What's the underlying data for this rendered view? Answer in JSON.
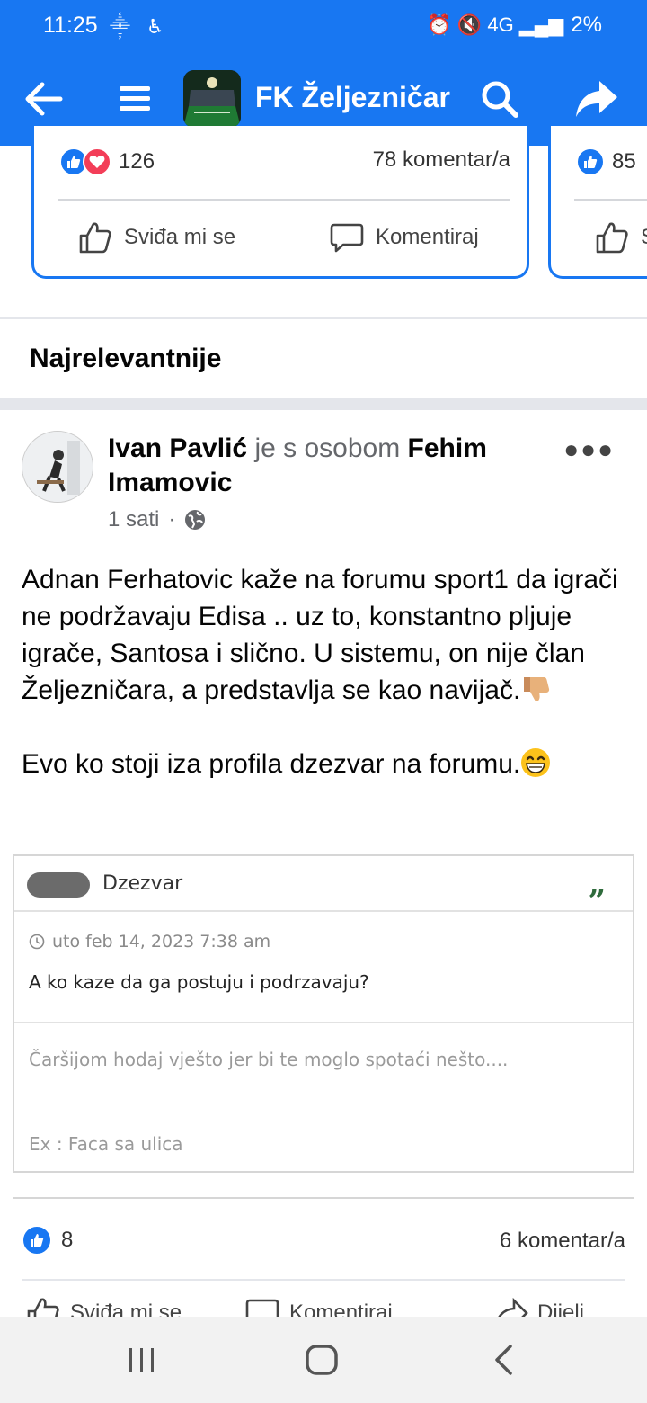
{
  "status_bar": {
    "time": "11:25",
    "left_icons": "⸎ ♿",
    "right_icons": "⏰ 🔇 4G ▂▄▆",
    "battery": "2%"
  },
  "header": {
    "title": "FK Željezničar"
  },
  "carousel": {
    "card1": {
      "reaction_count": "126",
      "comments": "78 komentar/a",
      "like_label": "Sviđa mi se",
      "comment_label": "Komentiraj"
    },
    "card2": {
      "reaction_count": "85",
      "like_label": "S"
    }
  },
  "section": {
    "title": "Najrelevantnije"
  },
  "post": {
    "author": "Ivan Pavlić",
    "with_text": " je s osobom ",
    "tagged": "Fehim Imamovic",
    "time": "1 sati",
    "visibility_separator": "·",
    "paragraph1": "Adnan Ferhatovic kaže na forumu sport1 da igrači ne podržavaju Edisa .. uz to, konstantno pljuje igrače, Santosa i slično. U sistemu, on nije član Željezničara, a predstavlja se kao navijač.",
    "paragraph2": "Evo ko stoji iza profila dzezvar na forumu.",
    "reactions_count": "8",
    "comments": "6 komentar/a",
    "actions": [
      "Sviđa mi se",
      "Komentiraj",
      "Dijeli"
    ]
  },
  "embedded": {
    "username": "Dzezvar",
    "quote_mark": "”",
    "date": "uto feb 14, 2023 7:38 am",
    "message": "A ko kaze da ga postuju i podrzavaju?",
    "signature1": "Čaršijom hodaj vješto jer bi te moglo spotaći nešto....",
    "signature2": "Ex : Faca sa ulica"
  },
  "colors": {
    "brand": "#1877f2",
    "love": "#f33e58"
  }
}
